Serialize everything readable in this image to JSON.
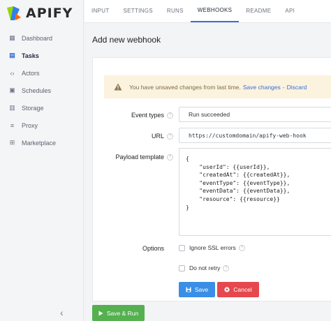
{
  "app": {
    "logo_text": "APIFY"
  },
  "sidebar": {
    "items": [
      {
        "label": "Dashboard",
        "icon": "dashboard-icon",
        "glyph": "▦",
        "active": false
      },
      {
        "label": "Tasks",
        "icon": "tasks-icon",
        "glyph": "▤",
        "active": true
      },
      {
        "label": "Actors",
        "icon": "code-icon",
        "glyph": "‹›",
        "active": false
      },
      {
        "label": "Schedules",
        "icon": "calendar-icon",
        "glyph": "▣",
        "active": false
      },
      {
        "label": "Storage",
        "icon": "storage-icon",
        "glyph": "▥",
        "active": false
      },
      {
        "label": "Proxy",
        "icon": "proxy-icon",
        "glyph": "≡",
        "active": false
      },
      {
        "label": "Marketplace",
        "icon": "cart-icon",
        "glyph": "⊞",
        "active": false
      }
    ],
    "collapse_glyph": "‹"
  },
  "tabs": [
    {
      "label": "INPUT",
      "active": false
    },
    {
      "label": "SETTINGS",
      "active": false
    },
    {
      "label": "RUNS",
      "active": false
    },
    {
      "label": "WEBHOOKS",
      "active": true
    },
    {
      "label": "README",
      "active": false
    },
    {
      "label": "API",
      "active": false
    }
  ],
  "page": {
    "title": "Add new webhook"
  },
  "warning": {
    "text": "You have unsaved changes from last time.",
    "save_link": "Save changes",
    "separator": "-",
    "discard_link": "Discard"
  },
  "form": {
    "event_types_label": "Event types",
    "event_types_value": "Run succeeded",
    "url_label": "URL",
    "url_value": "https://customdomain/apify-web-hook",
    "payload_label": "Payload template",
    "payload_value": "{\n    \"userId\": {{userId}},\n    \"createdAt\": {{createdAt}},\n    \"eventType\": {{eventType}},\n    \"eventData\": {{eventData}},\n    \"resource\": {{resource}}\n}",
    "options_label": "Options",
    "ignore_ssl_label": "Ignore SSL errors",
    "do_not_retry_label": "Do not retry",
    "help_glyph": "?"
  },
  "buttons": {
    "save": "Save",
    "cancel": "Cancel",
    "save_run": "Save & Run"
  },
  "colors": {
    "accent": "#3a6fd6",
    "save": "#3a8ee6",
    "cancel": "#e5484d",
    "run": "#55b04f",
    "warning_bg": "#fcf3df"
  }
}
